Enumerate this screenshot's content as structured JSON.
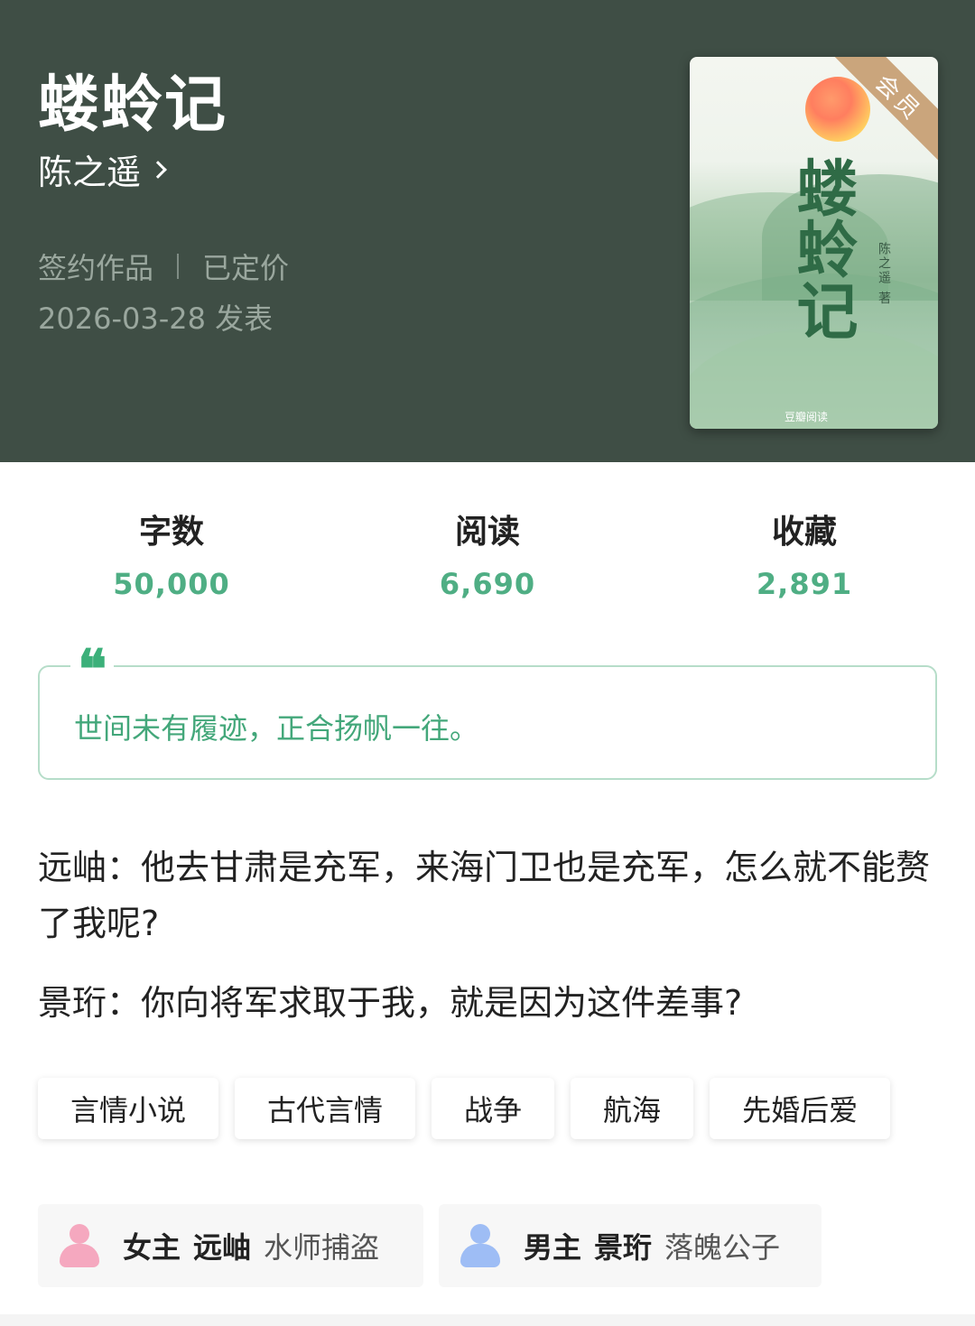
{
  "book": {
    "title": "蝼蛉记",
    "author": "陈之遥",
    "contract": "签约作品",
    "pricing": "已定价",
    "publish_date": "2026-03-28 发表"
  },
  "cover": {
    "badge": "会员",
    "title": "蝼蛉记",
    "author_line": "陈之遥 著",
    "brand": "豆瓣阅读"
  },
  "stats": [
    {
      "label": "字数",
      "value": "50,000"
    },
    {
      "label": "阅读",
      "value": "6,690"
    },
    {
      "label": "收藏",
      "value": "2,891"
    }
  ],
  "quote": {
    "icon": "quote-icon",
    "text": "世间未有履迹，正合扬帆一往。"
  },
  "description": {
    "line1": "远岫：他去甘肃是充军，来海门卫也是充军，怎么就不能赘了我呢?",
    "line2": "景珩：你向将军求取于我，就是因为这件差事?"
  },
  "tags": [
    "言情小说",
    "古代言情",
    "战争",
    "航海",
    "先婚后爱"
  ],
  "roles": [
    {
      "kind": "女主",
      "name": "远岫",
      "desc": "水师捕盗",
      "icon": "female-avatar-icon",
      "color": "#f5a8bf"
    },
    {
      "kind": "男主",
      "name": "景珩",
      "desc": "落魄公子",
      "icon": "male-avatar-icon",
      "color": "#9ebdf5"
    }
  ],
  "colors": {
    "header_bg": "#3f4e45",
    "accent_green": "#4fae84",
    "quote_border": "#b6ddc9"
  }
}
